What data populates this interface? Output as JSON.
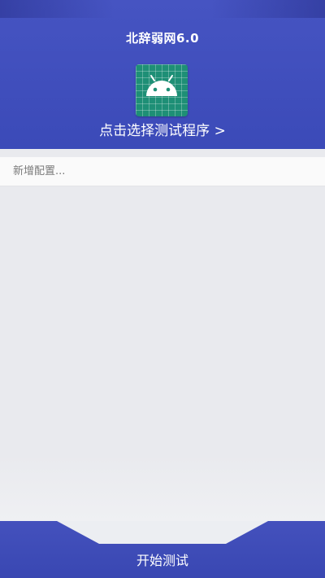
{
  "header": {
    "title": "北辞弱网6.0",
    "select_program_label": "点击选择测试程序 >",
    "app_icon": "android-icon"
  },
  "config": {
    "placeholder": "新增配置..."
  },
  "footer": {
    "start_label": "开始测试"
  },
  "colors": {
    "primary": "#3f4dbb",
    "icon_bg": "#1e8f76",
    "content_bg": "#e9eaee"
  }
}
